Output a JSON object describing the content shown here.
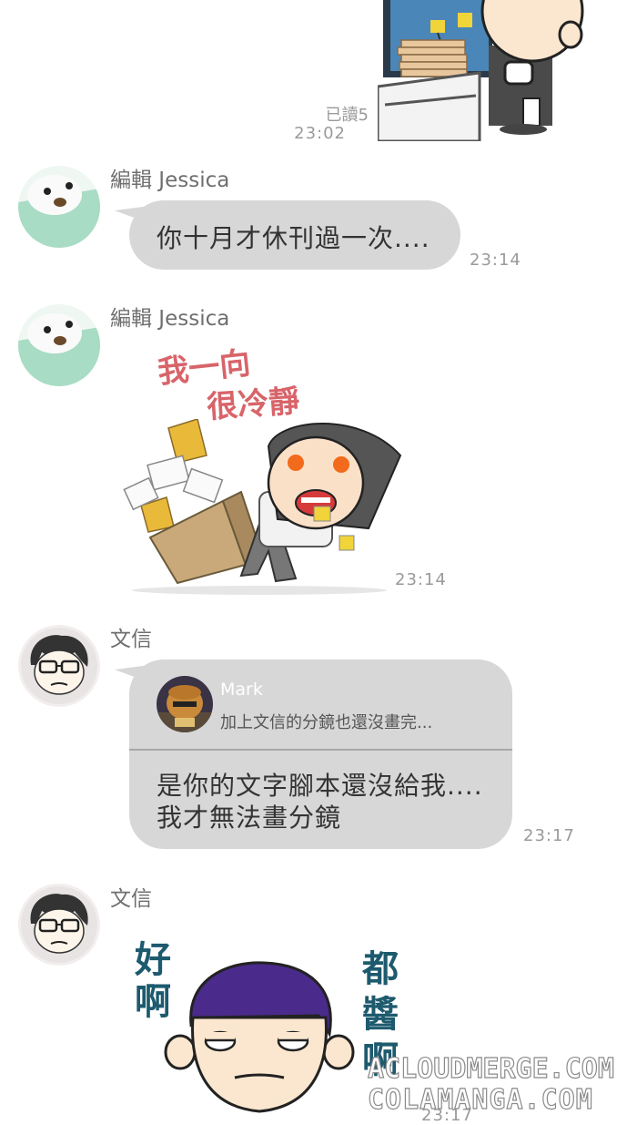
{
  "messages": [
    {
      "read_label": "已讀5",
      "time": "23:02"
    },
    {
      "sender": "編輯 Jessica",
      "text": "你十月才休刊過一次....",
      "time": "23:14"
    },
    {
      "sender": "編輯 Jessica",
      "sticker_text": [
        "我一向",
        "很冷靜"
      ],
      "time": "23:14"
    },
    {
      "sender": "文信",
      "reply": {
        "name": "Mark",
        "quote": "加上文信的分鏡也還沒畫完..."
      },
      "lines": [
        "是你的文字腳本還沒給我....",
        "我才無法畫分鏡"
      ],
      "time": "23:17"
    },
    {
      "sender": "文信",
      "sticker_left": [
        "好",
        "啊"
      ],
      "sticker_right": [
        "都",
        "醬",
        "啊"
      ],
      "time": "23:17"
    }
  ],
  "watermark": [
    "ACLOUDMERGE.COM",
    "COLAMANGA.COM"
  ],
  "colors": {
    "bubble": "#d7d7d7",
    "avatar_mint": "#a8dcc4",
    "sticker_red": "#d8646a",
    "sticker_teal": "#1d5a6e"
  }
}
